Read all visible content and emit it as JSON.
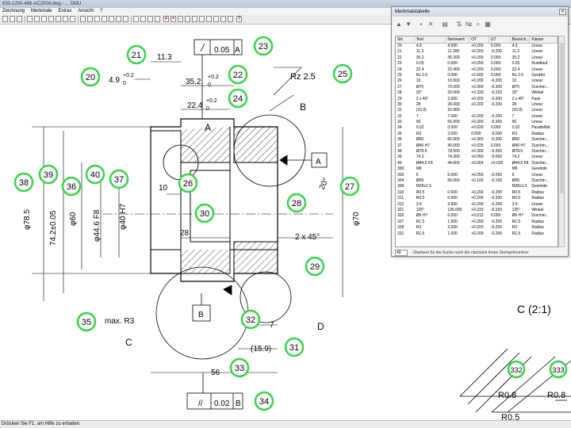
{
  "window": {
    "title": "830-1200-486-AC2004.dwg - ... DMU"
  },
  "menu": [
    "Zeichnung",
    "Merkmale",
    "Extras",
    "Ansicht",
    "?"
  ],
  "status": "Drücken Sie F1, um Hilfe zu erhalten.",
  "drawing": {
    "dims": [
      "11.3",
      "0.05",
      "A",
      "4.9",
      "+0.2",
      "0",
      "35.2",
      "+0.2",
      "0",
      "Rz 2.5",
      "22.4",
      "+0.2",
      "0",
      "B",
      "A",
      "A",
      "10",
      "φ78.5",
      "74.2±0.05",
      "φ60",
      "φ44.6 F8",
      "φ40 H7",
      "28",
      "20°",
      "φ70",
      "2 x 45°",
      "max. R3",
      "B",
      "C",
      "7",
      "D",
      "(15.9)",
      "56",
      "//",
      "0.02",
      "B",
      "C (2:1)",
      "R0.8",
      "R0.8",
      "R0.5"
    ],
    "balloons": [
      "21",
      "23",
      "20",
      "22",
      "25",
      "24",
      "38",
      "39",
      "36",
      "40",
      "37",
      "26",
      "30",
      "28",
      "27",
      "29",
      "35",
      "32",
      "31",
      "33",
      "34",
      "332",
      "333"
    ]
  },
  "panel": {
    "title": "Merkmalstabelle",
    "close": "×",
    "columns": [
      "Str.",
      "Text",
      "Nennwert",
      "OT",
      "UT",
      "Bezeich...",
      "Klasse"
    ],
    "rows": [
      [
        "20",
        "4.9",
        "4.900",
        "+0.200",
        "0.000",
        "4.9",
        "Linear"
      ],
      [
        "21",
        "11.3",
        "11.300",
        "+0.200",
        "-0.200",
        "11.3",
        "Linear"
      ],
      [
        "22",
        "35.2",
        "35.200",
        "+0.200",
        "0.000",
        "35.2",
        "Linear"
      ],
      [
        "23",
        "0.05",
        "0.000",
        "+0.050",
        "0.000",
        "0.05",
        "Rundlauf"
      ],
      [
        "24",
        "22.4",
        "22.400",
        "+0.200",
        "0.000",
        "22.4",
        "Linear"
      ],
      [
        "25",
        "Rz 2.5",
        "0.000",
        "+2.500",
        "0.000",
        "Rz 2.5",
        "Geräthl."
      ],
      [
        "26",
        "10",
        "10.000",
        "+0.200",
        "-0.200",
        "10",
        "Linear"
      ],
      [
        "27",
        "Ø70",
        "70.000",
        "+0.300",
        "-0.300",
        "Ø70",
        "Durchm..."
      ],
      [
        "28",
        "20°",
        "20.000",
        "+0.333",
        "-0.333",
        "20°",
        "Winkel"
      ],
      [
        "29",
        "2 x 45°",
        "2.000",
        "+0.200",
        "-0.200",
        "2 x 45°",
        "Fase"
      ],
      [
        "30",
        "28",
        "28.000",
        "+0.200",
        "-0.200",
        "28",
        "Linear"
      ],
      [
        "31",
        "(15.9)",
        "15.900",
        "",
        "",
        "(15.9)",
        "Linear"
      ],
      [
        "32",
        "7",
        "7.000",
        "+0.200",
        "-0.200",
        "7",
        "Linear"
      ],
      [
        "33",
        "56",
        "56.000",
        "+0.300",
        "-0.300",
        "56",
        "Linear"
      ],
      [
        "34",
        "0.02",
        "0.000",
        "+0.020",
        "0.000",
        "0.02",
        "Parallelität"
      ],
      [
        "35",
        "R3",
        "3.000",
        "0.000",
        "-3.000",
        "R3",
        "Radius"
      ],
      [
        "36",
        "Ø60",
        "60.000",
        "+0.300",
        "-0.300",
        "Ø60",
        "Durchm..."
      ],
      [
        "37",
        "Ø40 H7",
        "40.000",
        "+0.025",
        "0.000",
        "Ø40 H7",
        "Durchm..."
      ],
      [
        "38",
        "Ø78.5",
        "78.500",
        "+0.300",
        "-0.300",
        "Ø78.5",
        "Durchm..."
      ],
      [
        "39",
        "74.2",
        "74.200",
        "+0.050",
        "-0.050",
        "74.2",
        "Linear"
      ],
      [
        "40",
        "Ø44.6 F8",
        "44.600",
        "+0.064",
        "+0.025",
        "Ø44.6 F8",
        "Durchm..."
      ],
      [
        "300",
        "M6",
        "",
        "",
        "",
        "M6",
        "Gewinde"
      ],
      [
        "303",
        "6",
        "6.000",
        "+0.050",
        "-0.050",
        "6",
        "Linear"
      ],
      [
        "304",
        "Ø55",
        "55.000",
        "+0.100",
        "-0.100",
        "Ø55",
        "Durchm..."
      ],
      [
        "308",
        "M36x1.5",
        "",
        "",
        "",
        "M36x1.5",
        "Gewinde"
      ],
      [
        "310",
        "R0.5",
        "0.500",
        "+0.200",
        "-0.200",
        "R0.5",
        "Radius"
      ],
      [
        "311",
        "R0.5",
        "0.500",
        "+0.200",
        "-0.200",
        "R0.5",
        "Radius"
      ],
      [
        "312",
        "3.9",
        "3.900",
        "+0.200",
        "-0.200",
        "3.9",
        "Linear"
      ],
      [
        "321",
        "135°",
        "135.000",
        "+0.333",
        "-0.333",
        "135°",
        "Winkel"
      ],
      [
        "326",
        "Ø6 H7",
        "6.000",
        "+0.012",
        "0.000",
        "Ø6 H7",
        "Durchm..."
      ],
      [
        "327",
        "R1.5",
        "1.500",
        "+0.200",
        "-0.200",
        "R1.5",
        "Radius"
      ],
      [
        "328",
        "R3",
        "3.000",
        "+0.200",
        "-0.200",
        "R3",
        "Radius"
      ],
      [
        "331",
        "R1.5",
        "1.500",
        "+0.200",
        "-0.200",
        "R1.5",
        "Radius"
      ]
    ],
    "input_value": "40",
    "hint": "- Startwert für die Suche nach der nächsten freien Stempelnummer"
  }
}
